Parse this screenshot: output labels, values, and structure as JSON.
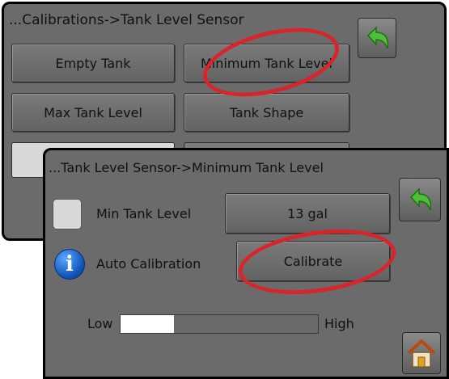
{
  "screen1": {
    "title": "...Calibrations->Tank Level Sensor",
    "buttons": {
      "empty_tank": "Empty Tank",
      "minimum_tank_level": "Minimum Tank Level",
      "max_tank_level": "Max Tank Level",
      "tank_shape": "Tank Shape"
    }
  },
  "screen2": {
    "title": "...Tank Level Sensor->Minimum Tank Level",
    "min_tank_level_label": "Min Tank Level",
    "min_tank_level_value": "13 gal",
    "auto_calibration_label": "Auto Calibration",
    "calibrate_button": "Calibrate",
    "info_glyph": "i",
    "slider": {
      "low_label": "Low",
      "high_label": "High",
      "fill_fraction": 0.27
    }
  },
  "icons": {
    "back": "back-arrow-icon",
    "home": "home-icon",
    "info": "info-icon"
  },
  "colors": {
    "highlight": "#d6262b",
    "back_arrow": "#4fbf3a",
    "info": "#1a6de0"
  }
}
